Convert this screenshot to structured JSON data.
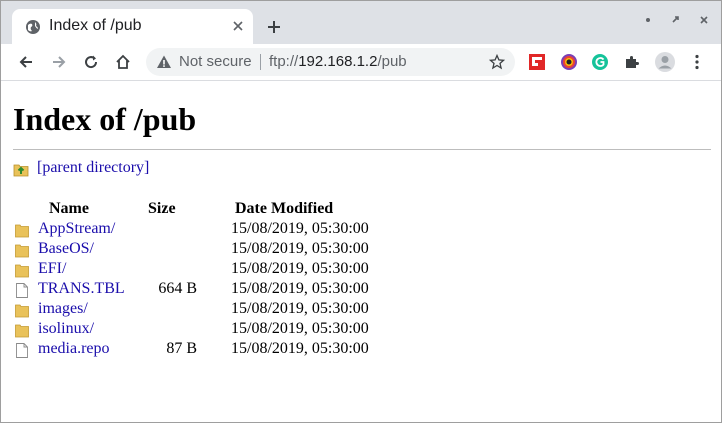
{
  "browser": {
    "tab_title": "Index of /pub",
    "security_label": "Not secure",
    "url_scheme": "ftp://",
    "url_host": "192.168.1.2",
    "url_path": "/pub"
  },
  "page": {
    "title": "Index of /pub",
    "parent_link": "[parent directory]",
    "columns": {
      "name": "Name",
      "size": "Size",
      "date": "Date Modified"
    },
    "rows": [
      {
        "name": "AppStream/",
        "size": "",
        "date": "15/08/2019, 05:30:00",
        "type": "folder"
      },
      {
        "name": "BaseOS/",
        "size": "",
        "date": "15/08/2019, 05:30:00",
        "type": "folder"
      },
      {
        "name": "EFI/",
        "size": "",
        "date": "15/08/2019, 05:30:00",
        "type": "folder"
      },
      {
        "name": "TRANS.TBL",
        "size": "664 B",
        "date": "15/08/2019, 05:30:00",
        "type": "file"
      },
      {
        "name": "images/",
        "size": "",
        "date": "15/08/2019, 05:30:00",
        "type": "folder"
      },
      {
        "name": "isolinux/",
        "size": "",
        "date": "15/08/2019, 05:30:00",
        "type": "folder"
      },
      {
        "name": "media.repo",
        "size": "87 B",
        "date": "15/08/2019, 05:30:00",
        "type": "file"
      }
    ]
  },
  "icons": {
    "favicon": "globe-icon",
    "folder": "folder-icon",
    "file": "file-icon",
    "parent": "folder-up-icon"
  },
  "colors": {
    "link": "#1a0dab",
    "folder": "#e9c25a",
    "tabstrip": "#dee1e6"
  }
}
